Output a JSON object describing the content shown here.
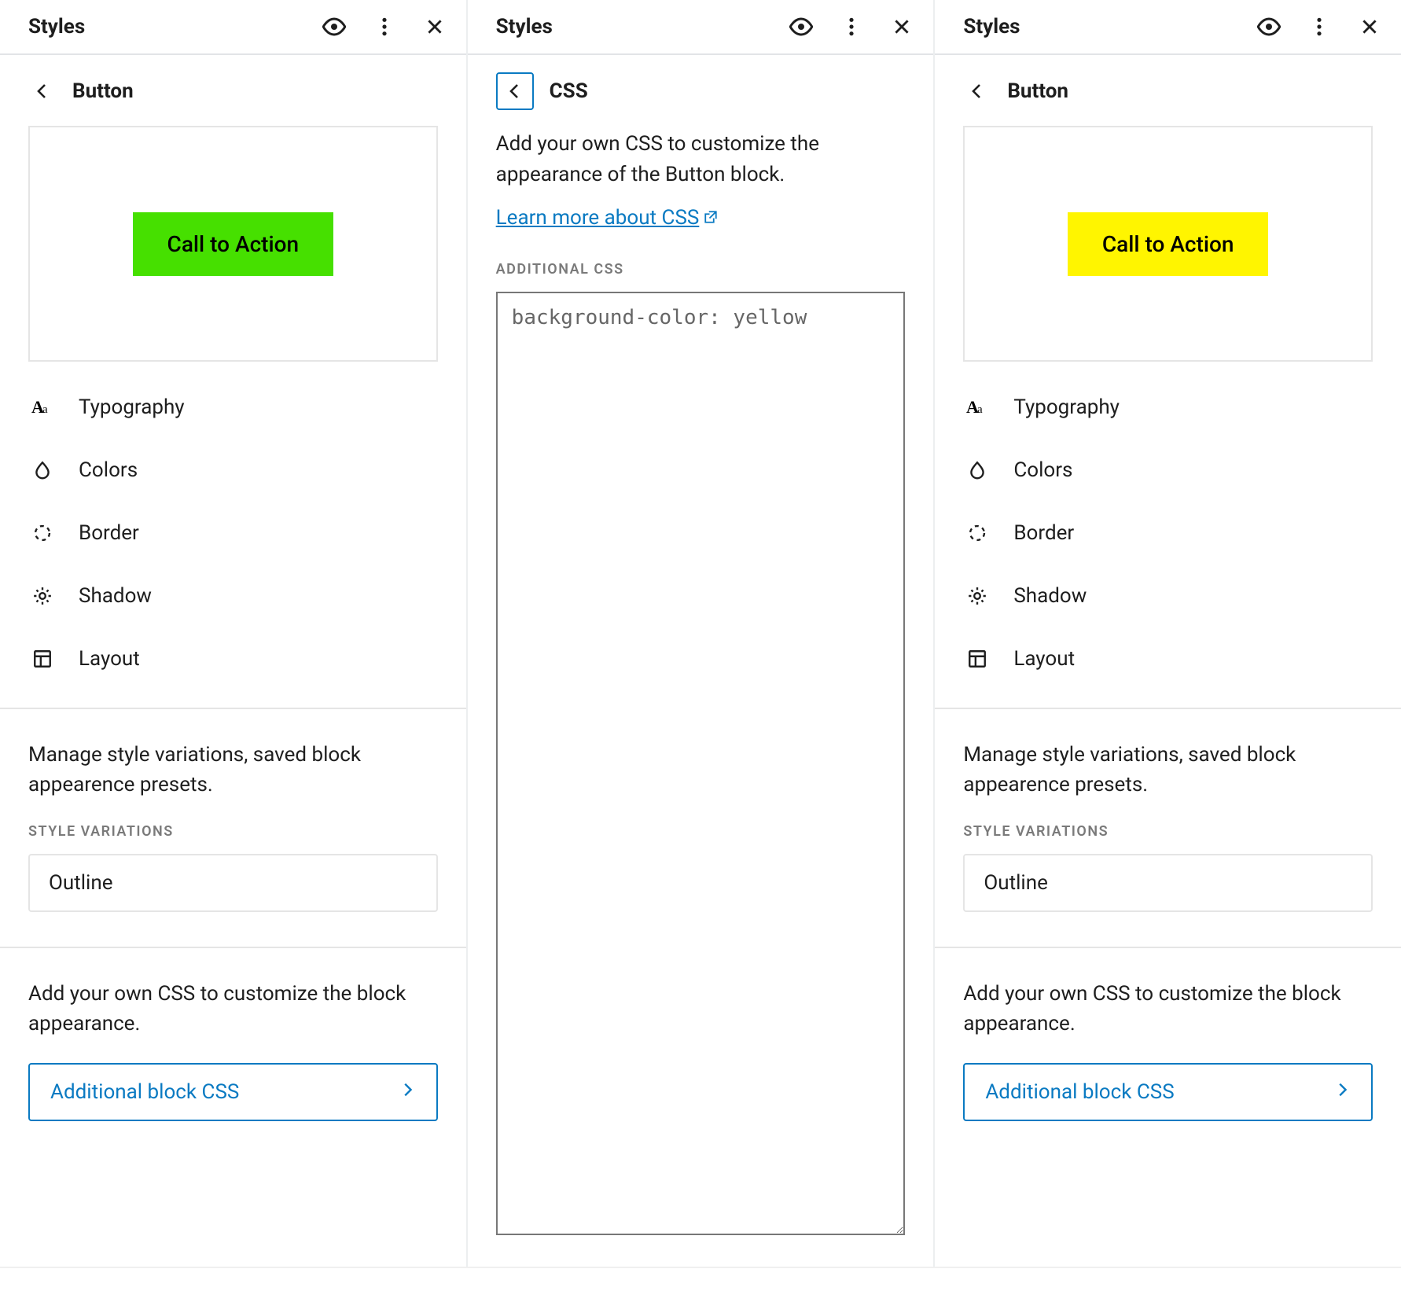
{
  "header_title": "Styles",
  "panels": {
    "left": {
      "breadcrumb": "Button",
      "cta_label": "Call to Action",
      "cta_bg": "#46E000",
      "settings": [
        {
          "label": "Typography",
          "icon": "typography"
        },
        {
          "label": "Colors",
          "icon": "drop"
        },
        {
          "label": "Border",
          "icon": "border"
        },
        {
          "label": "Shadow",
          "icon": "sun"
        },
        {
          "label": "Layout",
          "icon": "layout"
        }
      ],
      "variations_desc": "Manage style variations, saved block appearence presets.",
      "variations_heading": "STYLE VARIATIONS",
      "variation_item": "Outline",
      "css_desc": "Add your own CSS to customize the block appearance.",
      "css_button": "Additional block CSS"
    },
    "middle": {
      "breadcrumb": "CSS",
      "desc": "Add your own CSS to customize the appearance of the Button block.",
      "learn_link": "Learn more about CSS",
      "heading": "ADDITIONAL CSS",
      "editor_value": "background-color: yellow"
    },
    "right": {
      "breadcrumb": "Button",
      "cta_label": "Call to Action",
      "cta_bg": "#FFF500",
      "settings": [
        {
          "label": "Typography",
          "icon": "typography"
        },
        {
          "label": "Colors",
          "icon": "drop"
        },
        {
          "label": "Border",
          "icon": "border"
        },
        {
          "label": "Shadow",
          "icon": "sun"
        },
        {
          "label": "Layout",
          "icon": "layout"
        }
      ],
      "variations_desc": "Manage style variations, saved block appearence presets.",
      "variations_heading": "STYLE VARIATIONS",
      "variation_item": "Outline",
      "css_desc": "Add your own CSS to customize the block appearance.",
      "css_button": "Additional block CSS"
    }
  }
}
